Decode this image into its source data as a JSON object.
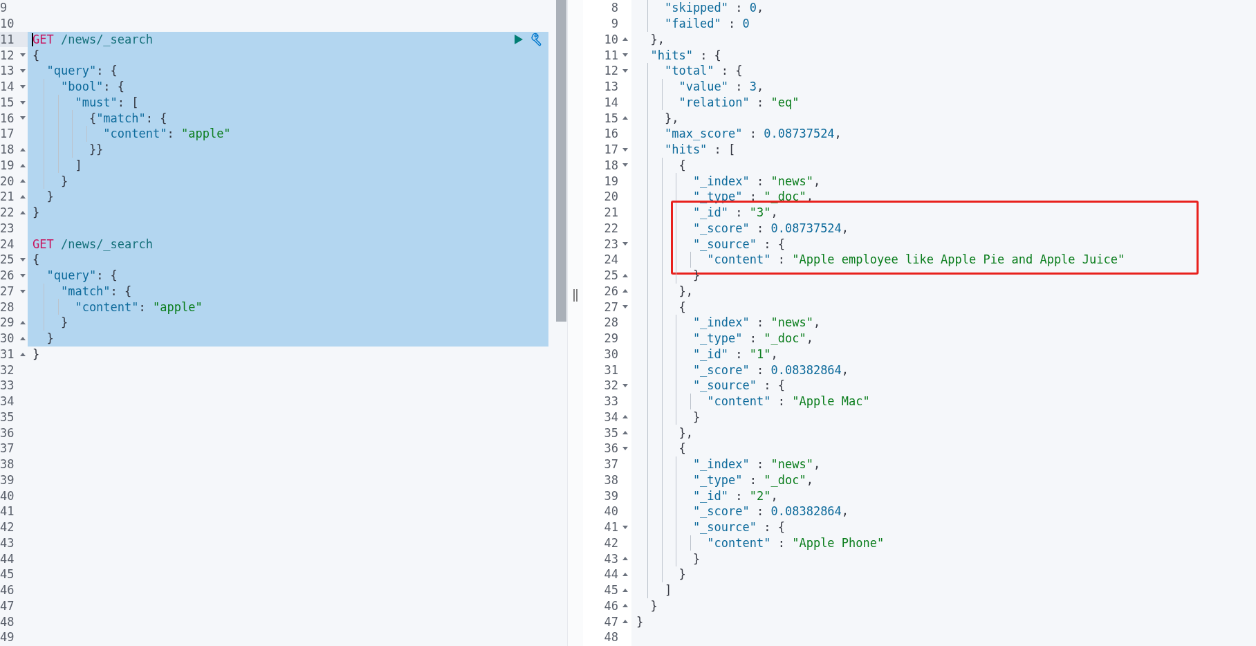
{
  "request_editor": {
    "lines": [
      {
        "number": "9",
        "fold_start": false,
        "fold_end": false,
        "selected": false,
        "cursor": false
      },
      {
        "number": "10",
        "fold_start": false,
        "fold_end": false,
        "selected": false,
        "cursor": false
      },
      {
        "number": "11",
        "fold_start": false,
        "fold_end": false,
        "selected": true,
        "cursor": true,
        "tokens": [
          {
            "kind": "method",
            "text": "GET"
          },
          {
            "kind": "url",
            "text": " /news/_search"
          }
        ]
      },
      {
        "number": "12",
        "fold_start": true,
        "fold_end": false,
        "selected": true,
        "cursor": false,
        "tokens": [
          {
            "kind": "punct",
            "text": "{"
          }
        ]
      },
      {
        "number": "13",
        "fold_start": true,
        "fold_end": false,
        "selected": true,
        "cursor": false,
        "tokens": [
          {
            "kind": "key",
            "text": "  \"query\""
          },
          {
            "kind": "punct",
            "text": ": {"
          }
        ]
      },
      {
        "number": "14",
        "fold_start": true,
        "fold_end": false,
        "selected": true,
        "cursor": false,
        "tokens": [
          {
            "kind": "key",
            "text": "    \"bool\""
          },
          {
            "kind": "punct",
            "text": ": {"
          }
        ]
      },
      {
        "number": "15",
        "fold_start": true,
        "fold_end": false,
        "selected": true,
        "cursor": false,
        "tokens": [
          {
            "kind": "key",
            "text": "      \"must\""
          },
          {
            "kind": "punct",
            "text": ": ["
          }
        ]
      },
      {
        "number": "16",
        "fold_start": true,
        "fold_end": false,
        "selected": true,
        "cursor": false,
        "tokens": [
          {
            "kind": "punct",
            "text": "        {"
          },
          {
            "kind": "key",
            "text": "\"match\""
          },
          {
            "kind": "punct",
            "text": ": {"
          }
        ]
      },
      {
        "number": "17",
        "fold_start": false,
        "fold_end": false,
        "selected": true,
        "cursor": false,
        "tokens": [
          {
            "kind": "key",
            "text": "          \"content\""
          },
          {
            "kind": "punct",
            "text": ": "
          },
          {
            "kind": "string",
            "text": "\"apple\""
          }
        ]
      },
      {
        "number": "18",
        "fold_start": false,
        "fold_end": true,
        "selected": true,
        "cursor": false,
        "tokens": [
          {
            "kind": "punct",
            "text": "        }}"
          }
        ]
      },
      {
        "number": "19",
        "fold_start": false,
        "fold_end": true,
        "selected": true,
        "cursor": false,
        "tokens": [
          {
            "kind": "punct",
            "text": "      ]"
          }
        ]
      },
      {
        "number": "20",
        "fold_start": false,
        "fold_end": true,
        "selected": true,
        "cursor": false,
        "tokens": [
          {
            "kind": "punct",
            "text": "    }"
          }
        ]
      },
      {
        "number": "21",
        "fold_start": false,
        "fold_end": true,
        "selected": true,
        "cursor": false,
        "tokens": [
          {
            "kind": "punct",
            "text": "  }"
          }
        ]
      },
      {
        "number": "22",
        "fold_start": false,
        "fold_end": true,
        "selected": true,
        "cursor": false,
        "tokens": [
          {
            "kind": "punct",
            "text": "}"
          }
        ]
      },
      {
        "number": "23",
        "fold_start": false,
        "fold_end": false,
        "selected": true,
        "cursor": false
      },
      {
        "number": "24",
        "fold_start": false,
        "fold_end": false,
        "selected": true,
        "cursor": false,
        "tokens": [
          {
            "kind": "method",
            "text": "GET"
          },
          {
            "kind": "url",
            "text": " /news/_search"
          }
        ]
      },
      {
        "number": "25",
        "fold_start": true,
        "fold_end": false,
        "selected": true,
        "cursor": false,
        "tokens": [
          {
            "kind": "punct",
            "text": "{"
          }
        ]
      },
      {
        "number": "26",
        "fold_start": true,
        "fold_end": false,
        "selected": true,
        "cursor": false,
        "tokens": [
          {
            "kind": "key",
            "text": "  \"query\""
          },
          {
            "kind": "punct",
            "text": ": {"
          }
        ]
      },
      {
        "number": "27",
        "fold_start": true,
        "fold_end": false,
        "selected": true,
        "cursor": false,
        "tokens": [
          {
            "kind": "key",
            "text": "    \"match\""
          },
          {
            "kind": "punct",
            "text": ": {"
          }
        ]
      },
      {
        "number": "28",
        "fold_start": false,
        "fold_end": false,
        "selected": true,
        "cursor": false,
        "tokens": [
          {
            "kind": "key",
            "text": "      \"content\""
          },
          {
            "kind": "punct",
            "text": ": "
          },
          {
            "kind": "string",
            "text": "\"apple\""
          }
        ]
      },
      {
        "number": "29",
        "fold_start": false,
        "fold_end": true,
        "selected": true,
        "cursor": false,
        "tokens": [
          {
            "kind": "punct",
            "text": "    }"
          }
        ]
      },
      {
        "number": "30",
        "fold_start": false,
        "fold_end": true,
        "selected": true,
        "cursor": false,
        "tokens": [
          {
            "kind": "punct",
            "text": "  }"
          }
        ]
      },
      {
        "number": "31",
        "fold_start": false,
        "fold_end": true,
        "selected": false,
        "cursor": false,
        "tokens": [
          {
            "kind": "punct",
            "text": "}"
          }
        ]
      },
      {
        "number": "32",
        "fold_start": false,
        "fold_end": false,
        "selected": false,
        "cursor": false
      },
      {
        "number": "33",
        "fold_start": false,
        "fold_end": false,
        "selected": false,
        "cursor": false
      },
      {
        "number": "34",
        "fold_start": false,
        "fold_end": false,
        "selected": false,
        "cursor": false
      },
      {
        "number": "35",
        "fold_start": false,
        "fold_end": false,
        "selected": false,
        "cursor": false
      },
      {
        "number": "36",
        "fold_start": false,
        "fold_end": false,
        "selected": false,
        "cursor": false
      },
      {
        "number": "37",
        "fold_start": false,
        "fold_end": false,
        "selected": false,
        "cursor": false
      },
      {
        "number": "38",
        "fold_start": false,
        "fold_end": false,
        "selected": false,
        "cursor": false
      },
      {
        "number": "39",
        "fold_start": false,
        "fold_end": false,
        "selected": false,
        "cursor": false
      },
      {
        "number": "40",
        "fold_start": false,
        "fold_end": false,
        "selected": false,
        "cursor": false
      },
      {
        "number": "41",
        "fold_start": false,
        "fold_end": false,
        "selected": false,
        "cursor": false
      },
      {
        "number": "42",
        "fold_start": false,
        "fold_end": false,
        "selected": false,
        "cursor": false
      },
      {
        "number": "43",
        "fold_start": false,
        "fold_end": false,
        "selected": false,
        "cursor": false
      },
      {
        "number": "44",
        "fold_start": false,
        "fold_end": false,
        "selected": false,
        "cursor": false
      },
      {
        "number": "45",
        "fold_start": false,
        "fold_end": false,
        "selected": false,
        "cursor": false
      },
      {
        "number": "46",
        "fold_start": false,
        "fold_end": false,
        "selected": false,
        "cursor": false
      },
      {
        "number": "47",
        "fold_start": false,
        "fold_end": false,
        "selected": false,
        "cursor": false
      },
      {
        "number": "48",
        "fold_start": false,
        "fold_end": false,
        "selected": false,
        "cursor": false
      },
      {
        "number": "49",
        "fold_start": false,
        "fold_end": false,
        "selected": false,
        "cursor": false
      }
    ]
  },
  "response_viewer": {
    "lines": [
      {
        "number": "8",
        "fold_start": false,
        "fold_end": false,
        "boxed": false,
        "tokens": [
          {
            "kind": "key",
            "text": "    \"skipped\""
          },
          {
            "kind": "punct",
            "text": " : "
          },
          {
            "kind": "number",
            "text": "0"
          },
          {
            "kind": "punct",
            "text": ","
          }
        ]
      },
      {
        "number": "9",
        "fold_start": false,
        "fold_end": false,
        "boxed": false,
        "tokens": [
          {
            "kind": "key",
            "text": "    \"failed\""
          },
          {
            "kind": "punct",
            "text": " : "
          },
          {
            "kind": "number",
            "text": "0"
          }
        ]
      },
      {
        "number": "10",
        "fold_start": false,
        "fold_end": true,
        "boxed": false,
        "tokens": [
          {
            "kind": "punct",
            "text": "  },"
          }
        ]
      },
      {
        "number": "11",
        "fold_start": true,
        "fold_end": false,
        "boxed": false,
        "tokens": [
          {
            "kind": "key",
            "text": "  \"hits\""
          },
          {
            "kind": "punct",
            "text": " : {"
          }
        ]
      },
      {
        "number": "12",
        "fold_start": true,
        "fold_end": false,
        "boxed": false,
        "tokens": [
          {
            "kind": "key",
            "text": "    \"total\""
          },
          {
            "kind": "punct",
            "text": " : {"
          }
        ]
      },
      {
        "number": "13",
        "fold_start": false,
        "fold_end": false,
        "boxed": false,
        "tokens": [
          {
            "kind": "key",
            "text": "      \"value\""
          },
          {
            "kind": "punct",
            "text": " : "
          },
          {
            "kind": "number",
            "text": "3"
          },
          {
            "kind": "punct",
            "text": ","
          }
        ]
      },
      {
        "number": "14",
        "fold_start": false,
        "fold_end": false,
        "boxed": false,
        "tokens": [
          {
            "kind": "key",
            "text": "      \"relation\""
          },
          {
            "kind": "punct",
            "text": " : "
          },
          {
            "kind": "string",
            "text": "\"eq\""
          }
        ]
      },
      {
        "number": "15",
        "fold_start": false,
        "fold_end": true,
        "boxed": false,
        "tokens": [
          {
            "kind": "punct",
            "text": "    },"
          }
        ]
      },
      {
        "number": "16",
        "fold_start": false,
        "fold_end": false,
        "boxed": false,
        "tokens": [
          {
            "kind": "key",
            "text": "    \"max_score\""
          },
          {
            "kind": "punct",
            "text": " : "
          },
          {
            "kind": "number",
            "text": "0.08737524"
          },
          {
            "kind": "punct",
            "text": ","
          }
        ]
      },
      {
        "number": "17",
        "fold_start": true,
        "fold_end": false,
        "boxed": false,
        "tokens": [
          {
            "kind": "key",
            "text": "    \"hits\""
          },
          {
            "kind": "punct",
            "text": " : ["
          }
        ]
      },
      {
        "number": "18",
        "fold_start": true,
        "fold_end": false,
        "boxed": false,
        "tokens": [
          {
            "kind": "punct",
            "text": "      {"
          }
        ]
      },
      {
        "number": "19",
        "fold_start": false,
        "fold_end": false,
        "boxed": false,
        "tokens": [
          {
            "kind": "key",
            "text": "        \"_index\""
          },
          {
            "kind": "punct",
            "text": " : "
          },
          {
            "kind": "string",
            "text": "\"news\""
          },
          {
            "kind": "punct",
            "text": ","
          }
        ]
      },
      {
        "number": "20",
        "fold_start": false,
        "fold_end": false,
        "boxed": false,
        "tokens": [
          {
            "kind": "key",
            "text": "        \"_type\""
          },
          {
            "kind": "punct",
            "text": " : "
          },
          {
            "kind": "string",
            "text": "\"_doc\""
          },
          {
            "kind": "punct",
            "text": ","
          }
        ]
      },
      {
        "number": "21",
        "fold_start": false,
        "fold_end": false,
        "boxed": true,
        "tokens": [
          {
            "kind": "key",
            "text": "        \"_id\""
          },
          {
            "kind": "punct",
            "text": " : "
          },
          {
            "kind": "string",
            "text": "\"3\""
          },
          {
            "kind": "punct",
            "text": ","
          }
        ]
      },
      {
        "number": "22",
        "fold_start": false,
        "fold_end": false,
        "boxed": true,
        "tokens": [
          {
            "kind": "key",
            "text": "        \"_score\""
          },
          {
            "kind": "punct",
            "text": " : "
          },
          {
            "kind": "number",
            "text": "0.08737524"
          },
          {
            "kind": "punct",
            "text": ","
          }
        ]
      },
      {
        "number": "23",
        "fold_start": true,
        "fold_end": false,
        "boxed": true,
        "tokens": [
          {
            "kind": "key",
            "text": "        \"_source\""
          },
          {
            "kind": "punct",
            "text": " : {"
          }
        ]
      },
      {
        "number": "24",
        "fold_start": false,
        "fold_end": false,
        "boxed": true,
        "tokens": [
          {
            "kind": "key",
            "text": "          \"content\""
          },
          {
            "kind": "punct",
            "text": " : "
          },
          {
            "kind": "string",
            "text": "\"Apple employee like Apple Pie and Apple Juice\""
          }
        ]
      },
      {
        "number": "25",
        "fold_start": false,
        "fold_end": true,
        "boxed": false,
        "tokens": [
          {
            "kind": "punct",
            "text": "        }"
          }
        ]
      },
      {
        "number": "26",
        "fold_start": false,
        "fold_end": true,
        "boxed": false,
        "tokens": [
          {
            "kind": "punct",
            "text": "      },"
          }
        ]
      },
      {
        "number": "27",
        "fold_start": true,
        "fold_end": false,
        "boxed": false,
        "tokens": [
          {
            "kind": "punct",
            "text": "      {"
          }
        ]
      },
      {
        "number": "28",
        "fold_start": false,
        "fold_end": false,
        "boxed": false,
        "tokens": [
          {
            "kind": "key",
            "text": "        \"_index\""
          },
          {
            "kind": "punct",
            "text": " : "
          },
          {
            "kind": "string",
            "text": "\"news\""
          },
          {
            "kind": "punct",
            "text": ","
          }
        ]
      },
      {
        "number": "29",
        "fold_start": false,
        "fold_end": false,
        "boxed": false,
        "tokens": [
          {
            "kind": "key",
            "text": "        \"_type\""
          },
          {
            "kind": "punct",
            "text": " : "
          },
          {
            "kind": "string",
            "text": "\"_doc\""
          },
          {
            "kind": "punct",
            "text": ","
          }
        ]
      },
      {
        "number": "30",
        "fold_start": false,
        "fold_end": false,
        "boxed": false,
        "tokens": [
          {
            "kind": "key",
            "text": "        \"_id\""
          },
          {
            "kind": "punct",
            "text": " : "
          },
          {
            "kind": "string",
            "text": "\"1\""
          },
          {
            "kind": "punct",
            "text": ","
          }
        ]
      },
      {
        "number": "31",
        "fold_start": false,
        "fold_end": false,
        "boxed": false,
        "tokens": [
          {
            "kind": "key",
            "text": "        \"_score\""
          },
          {
            "kind": "punct",
            "text": " : "
          },
          {
            "kind": "number",
            "text": "0.08382864"
          },
          {
            "kind": "punct",
            "text": ","
          }
        ]
      },
      {
        "number": "32",
        "fold_start": true,
        "fold_end": false,
        "boxed": false,
        "tokens": [
          {
            "kind": "key",
            "text": "        \"_source\""
          },
          {
            "kind": "punct",
            "text": " : {"
          }
        ]
      },
      {
        "number": "33",
        "fold_start": false,
        "fold_end": false,
        "boxed": false,
        "tokens": [
          {
            "kind": "key",
            "text": "          \"content\""
          },
          {
            "kind": "punct",
            "text": " : "
          },
          {
            "kind": "string",
            "text": "\"Apple Mac\""
          }
        ]
      },
      {
        "number": "34",
        "fold_start": false,
        "fold_end": true,
        "boxed": false,
        "tokens": [
          {
            "kind": "punct",
            "text": "        }"
          }
        ]
      },
      {
        "number": "35",
        "fold_start": false,
        "fold_end": true,
        "boxed": false,
        "tokens": [
          {
            "kind": "punct",
            "text": "      },"
          }
        ]
      },
      {
        "number": "36",
        "fold_start": true,
        "fold_end": false,
        "boxed": false,
        "tokens": [
          {
            "kind": "punct",
            "text": "      {"
          }
        ]
      },
      {
        "number": "37",
        "fold_start": false,
        "fold_end": false,
        "boxed": false,
        "tokens": [
          {
            "kind": "key",
            "text": "        \"_index\""
          },
          {
            "kind": "punct",
            "text": " : "
          },
          {
            "kind": "string",
            "text": "\"news\""
          },
          {
            "kind": "punct",
            "text": ","
          }
        ]
      },
      {
        "number": "38",
        "fold_start": false,
        "fold_end": false,
        "boxed": false,
        "tokens": [
          {
            "kind": "key",
            "text": "        \"_type\""
          },
          {
            "kind": "punct",
            "text": " : "
          },
          {
            "kind": "string",
            "text": "\"_doc\""
          },
          {
            "kind": "punct",
            "text": ","
          }
        ]
      },
      {
        "number": "39",
        "fold_start": false,
        "fold_end": false,
        "boxed": false,
        "tokens": [
          {
            "kind": "key",
            "text": "        \"_id\""
          },
          {
            "kind": "punct",
            "text": " : "
          },
          {
            "kind": "string",
            "text": "\"2\""
          },
          {
            "kind": "punct",
            "text": ","
          }
        ]
      },
      {
        "number": "40",
        "fold_start": false,
        "fold_end": false,
        "boxed": false,
        "tokens": [
          {
            "kind": "key",
            "text": "        \"_score\""
          },
          {
            "kind": "punct",
            "text": " : "
          },
          {
            "kind": "number",
            "text": "0.08382864"
          },
          {
            "kind": "punct",
            "text": ","
          }
        ]
      },
      {
        "number": "41",
        "fold_start": true,
        "fold_end": false,
        "boxed": false,
        "tokens": [
          {
            "kind": "key",
            "text": "        \"_source\""
          },
          {
            "kind": "punct",
            "text": " : {"
          }
        ]
      },
      {
        "number": "42",
        "fold_start": false,
        "fold_end": false,
        "boxed": false,
        "tokens": [
          {
            "kind": "key",
            "text": "          \"content\""
          },
          {
            "kind": "punct",
            "text": " : "
          },
          {
            "kind": "string",
            "text": "\"Apple Phone\""
          }
        ]
      },
      {
        "number": "43",
        "fold_start": false,
        "fold_end": true,
        "boxed": false,
        "tokens": [
          {
            "kind": "punct",
            "text": "        }"
          }
        ]
      },
      {
        "number": "44",
        "fold_start": false,
        "fold_end": true,
        "boxed": false,
        "tokens": [
          {
            "kind": "punct",
            "text": "      }"
          }
        ]
      },
      {
        "number": "45",
        "fold_start": false,
        "fold_end": true,
        "boxed": false,
        "tokens": [
          {
            "kind": "punct",
            "text": "    ]"
          }
        ]
      },
      {
        "number": "46",
        "fold_start": false,
        "fold_end": true,
        "boxed": false,
        "tokens": [
          {
            "kind": "punct",
            "text": "  }"
          }
        ]
      },
      {
        "number": "47",
        "fold_start": false,
        "fold_end": true,
        "boxed": false,
        "tokens": [
          {
            "kind": "punct",
            "text": "}"
          }
        ]
      },
      {
        "number": "48",
        "fold_start": false,
        "fold_end": false,
        "boxed": false
      }
    ]
  }
}
